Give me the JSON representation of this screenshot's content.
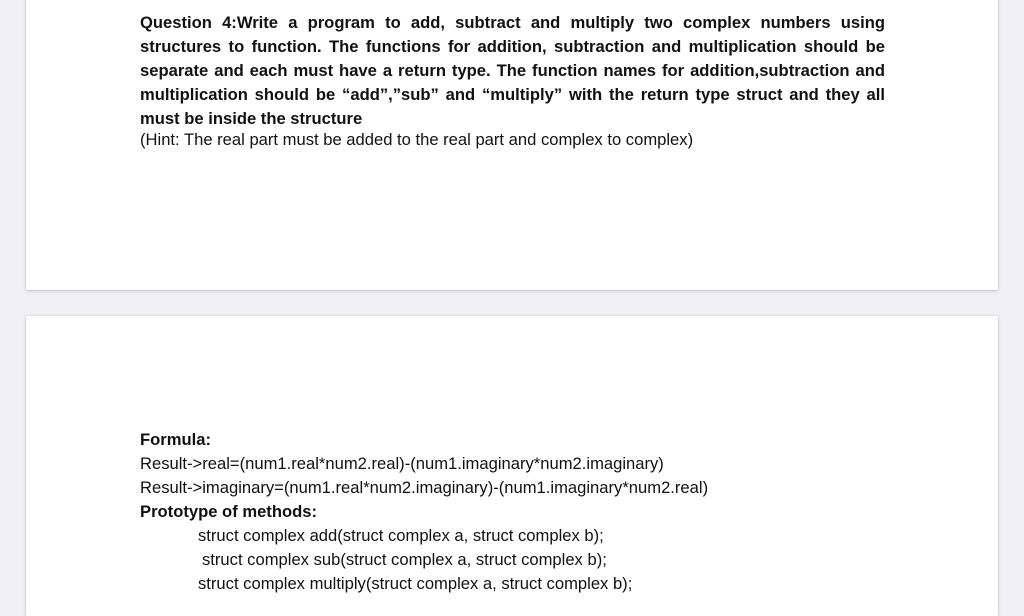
{
  "question": {
    "text": "Question 4:Write a program to add, subtract and multiply two complex numbers using structures to function. The functions for addition, subtraction and multiplication should be separate and each must have a return type. The function names for addition,subtraction and multiplication should be “add”,”sub”  and “multiply” with the return type struct and they all must be inside the structure",
    "hint": "(Hint: The real part must be added to the real part and complex to complex)"
  },
  "formula": {
    "heading": "Formula:",
    "lines": [
      "Result->real=(num1.real*num2.real)-(num1.imaginary*num2.imaginary)",
      "Result->imaginary=(num1.real*num2.imaginary)-(num1.imaginary*num2.real)"
    ]
  },
  "prototypes": {
    "heading": "Prototype of methods:",
    "lines": [
      "struct complex add(struct complex a, struct complex b);",
      "struct complex sub(struct complex a, struct complex b);",
      "struct complex multiply(struct complex a, struct complex b);"
    ]
  }
}
